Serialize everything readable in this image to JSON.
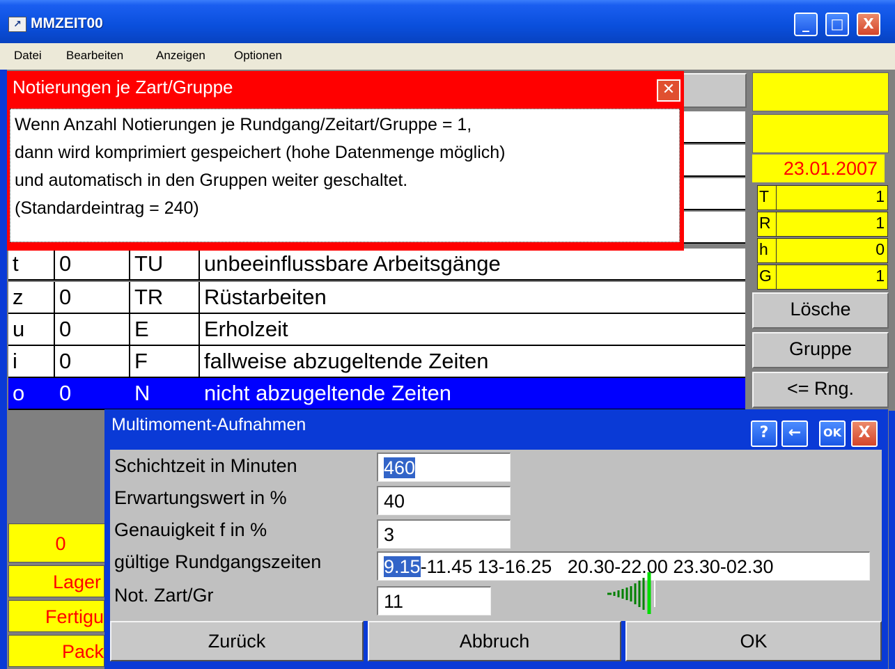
{
  "window": {
    "title": "MMZEIT00",
    "buttons": {
      "minimize": "_",
      "maximize": "□",
      "close": "X"
    }
  },
  "menu": [
    "Datei",
    "Bearbeiten",
    "Anzeigen",
    "Optionen"
  ],
  "tooltip": {
    "title": "Notierungen je Zart/Gruppe",
    "lines": [
      "Wenn Anzahl Notierungen je Rundgang/Zeitart/Gruppe = 1,",
      "dann wird komprimiert gespeichert (hohe Datenmenge möglich)",
      "und automatisch in den Gruppen weiter geschaltet.",
      "(Standardeintrag = 240)"
    ]
  },
  "table_rows": [
    {
      "key": "t",
      "count": "0",
      "code": "TU",
      "desc": "unbeeinflussbare Arbeitsgänge"
    },
    {
      "key": "z",
      "count": "0",
      "code": "TR",
      "desc": "Rüstarbeiten"
    },
    {
      "key": "u",
      "count": "0",
      "code": "E",
      "desc": "Erholzeit"
    },
    {
      "key": "i",
      "count": "0",
      "code": "F",
      "desc": "fallweise abzugeltende Zeiten"
    },
    {
      "key": "o",
      "count": "0",
      "code": "N",
      "desc": "nicht abzugeltende Zeiten"
    }
  ],
  "right_panel": {
    "date": "23.01.2007",
    "stats": [
      {
        "key": "T",
        "value": "1"
      },
      {
        "key": "R",
        "value": "1"
      },
      {
        "key": "h",
        "value": "0"
      },
      {
        "key": "G",
        "value": "1"
      }
    ],
    "buttons": [
      "Lösche",
      "Gruppe",
      "<= Rng."
    ]
  },
  "left_items": {
    "counter": "0",
    "items": [
      "Lager",
      "Fertigu",
      "Pack"
    ]
  },
  "dialog": {
    "title": "Multimoment-Aufnahmen",
    "title_buttons": [
      "?",
      "←",
      "OK",
      "X"
    ],
    "fields": [
      {
        "label": "Schichtzeit in Minuten",
        "value": "460"
      },
      {
        "label": "Erwartungswert in %",
        "value": "40"
      },
      {
        "label": "Genauigkeit f in %",
        "value": "3"
      },
      {
        "label": "gültige Rundgangszeiten",
        "value_highlight": "9.15",
        "value_rest": "-11.45 13-16.25   20.30-22.00 23.30-02.30"
      },
      {
        "label": "Not. Zart/Gr",
        "value": "11"
      }
    ],
    "footer_buttons": [
      "Zurück",
      "Abbruch",
      "OK"
    ]
  },
  "colors": {
    "title_blue": "#0a3ad6",
    "yellow": "#ffff00",
    "red": "#ff0000",
    "selection": "#0000ff"
  }
}
